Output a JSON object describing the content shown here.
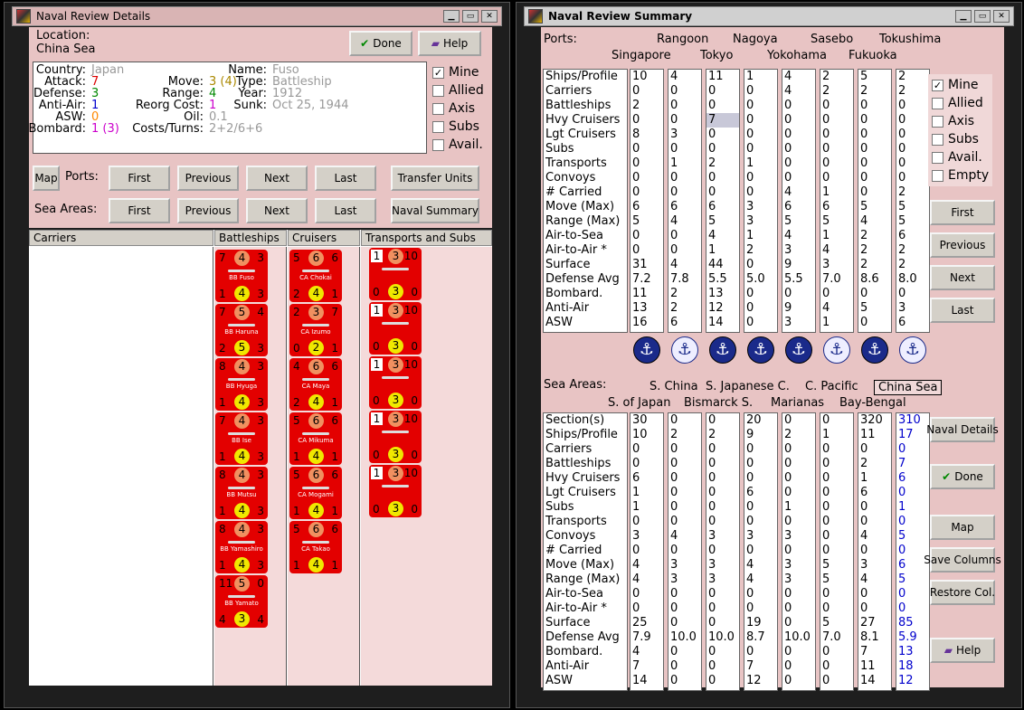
{
  "left": {
    "title": "Naval Review Details",
    "location_label": "Location:",
    "location_value": "China Sea",
    "done": "Done",
    "help": "Help",
    "info": {
      "country_l": "Country:",
      "country": "Japan",
      "attack_l": "Attack:",
      "attack": "7",
      "defense_l": "Defense:",
      "defense": "3",
      "antiair_l": "Anti-Air:",
      "antiair": "1",
      "asw_l": "ASW:",
      "asw": "0",
      "bombard_l": "Bombard:",
      "bombard": "1 (3)",
      "move_l": "Move:",
      "move": "3 (4)",
      "range_l": "Range:",
      "range": "4",
      "reorg_l": "Reorg Cost:",
      "reorg": "1",
      "oil_l": "Oil:",
      "oil": "0.1",
      "cost_l": "Costs/Turns:",
      "cost": "2+2/6+6",
      "name_l": "Name:",
      "name": "Fuso",
      "type_l": "Type:",
      "type": "Battleship",
      "year_l": "Year:",
      "year": "1912",
      "sunk_l": "Sunk:",
      "sunk": "Oct 25, 1944"
    },
    "checks": [
      "Mine",
      "Allied",
      "Axis",
      "Subs",
      "Avail."
    ],
    "map": "Map",
    "ports_l": "Ports:",
    "seas_l": "Sea Areas:",
    "nav": [
      "First",
      "Previous",
      "Next",
      "Last"
    ],
    "transfer": "Transfer Units",
    "naval_summary": "Naval Summary",
    "cols": [
      "Carriers",
      "Battleships",
      "Cruisers",
      "Transports and Subs"
    ],
    "battleships": [
      {
        "a": "7",
        "b": "4",
        "c": "3",
        "n": "BB Fuso",
        "d": "1",
        "e": "4",
        "f": "3"
      },
      {
        "a": "7",
        "b": "5",
        "c": "4",
        "n": "BB Haruna",
        "d": "2",
        "e": "5",
        "f": "3"
      },
      {
        "a": "8",
        "b": "4",
        "c": "3",
        "n": "BB Hyuga",
        "d": "1",
        "e": "4",
        "f": "3"
      },
      {
        "a": "7",
        "b": "4",
        "c": "3",
        "n": "BB Ise",
        "d": "1",
        "e": "4",
        "f": "3"
      },
      {
        "a": "8",
        "b": "4",
        "c": "3",
        "n": "BB Mutsu",
        "d": "1",
        "e": "4",
        "f": "3"
      },
      {
        "a": "8",
        "b": "4",
        "c": "3",
        "n": "BB Yamashiro",
        "d": "1",
        "e": "4",
        "f": "3"
      },
      {
        "a": "11",
        "b": "5",
        "c": "0",
        "n": "BB Yamato",
        "d": "4",
        "e": "3",
        "f": "4"
      }
    ],
    "cruisers": [
      {
        "a": "5",
        "b": "6",
        "c": "6",
        "n": "CA Chokai",
        "d": "2",
        "e": "4",
        "f": "1"
      },
      {
        "a": "2",
        "b": "3",
        "c": "7",
        "n": "CA Izumo",
        "d": "0",
        "e": "2",
        "f": "1"
      },
      {
        "a": "4",
        "b": "6",
        "c": "6",
        "n": "CA Maya",
        "d": "2",
        "e": "4",
        "f": "1"
      },
      {
        "a": "5",
        "b": "6",
        "c": "6",
        "n": "CA Mikuma",
        "d": "1",
        "e": "4",
        "f": "1"
      },
      {
        "a": "5",
        "b": "6",
        "c": "6",
        "n": "CA Mogami",
        "d": "1",
        "e": "4",
        "f": "1"
      },
      {
        "a": "5",
        "b": "6",
        "c": "6",
        "n": "CA Takao",
        "d": "1",
        "e": "4",
        "f": "1"
      }
    ],
    "transports": [
      {
        "a": "1",
        "b": "3",
        "c": "10",
        "d": "0",
        "e": "3",
        "f": "0"
      },
      {
        "a": "1",
        "b": "3",
        "c": "10",
        "d": "0",
        "e": "3",
        "f": "0"
      },
      {
        "a": "1",
        "b": "3",
        "c": "10",
        "d": "0",
        "e": "3",
        "f": "0"
      },
      {
        "a": "1",
        "b": "3",
        "c": "10",
        "d": "0",
        "e": "3",
        "f": "0"
      },
      {
        "a": "1",
        "b": "3",
        "c": "10",
        "d": "0",
        "e": "3",
        "f": "0"
      }
    ]
  },
  "right": {
    "title": "Naval Review Summary",
    "ports_l": "Ports:",
    "ports_top": [
      "Rangoon",
      "Nagoya",
      "Sasebo",
      "Tokushima"
    ],
    "ports_bot": [
      "Singapore",
      "Tokyo",
      "Yokohama",
      "Fukuoka"
    ],
    "rows": [
      "Ships/Profile",
      "Carriers",
      "Battleships",
      "Hvy Cruisers",
      "Lgt Cruisers",
      "Subs",
      "Transports",
      "Convoys",
      "# Carried",
      "Move (Max)",
      "Range (Max)",
      "Air-to-Sea",
      "Air-to-Air *",
      "Surface",
      "Defense Avg",
      "Bombard.",
      "Anti-Air",
      "ASW"
    ],
    "port_cols": [
      [
        "10",
        "0",
        "2",
        "0",
        "8",
        "0",
        "0",
        "0",
        "0",
        "6",
        "5",
        "0",
        "0",
        "31",
        "7.2",
        "11",
        "13",
        "16"
      ],
      [
        "4",
        "0",
        "0",
        "0",
        "3",
        "0",
        "1",
        "0",
        "0",
        "6",
        "4",
        "0",
        "0",
        "4",
        "7.8",
        "2",
        "2",
        "6"
      ],
      [
        "11",
        "0",
        "0",
        "7",
        "0",
        "0",
        "2",
        "0",
        "0",
        "6",
        "5",
        "4",
        "1",
        "44",
        "5.5",
        "13",
        "12",
        "14"
      ],
      [
        "1",
        "0",
        "0",
        "0",
        "0",
        "0",
        "1",
        "0",
        "0",
        "3",
        "3",
        "1",
        "2",
        "0",
        "5.0",
        "0",
        "0",
        "0"
      ],
      [
        "4",
        "4",
        "0",
        "0",
        "0",
        "0",
        "0",
        "0",
        "4",
        "6",
        "5",
        "4",
        "3",
        "9",
        "5.5",
        "0",
        "9",
        "3"
      ],
      [
        "2",
        "2",
        "0",
        "0",
        "0",
        "0",
        "0",
        "0",
        "1",
        "6",
        "5",
        "1",
        "4",
        "3",
        "7.0",
        "0",
        "4",
        "1"
      ],
      [
        "5",
        "2",
        "0",
        "0",
        "0",
        "0",
        "0",
        "0",
        "0",
        "5",
        "4",
        "2",
        "2",
        "2",
        "8.6",
        "0",
        "5",
        "0"
      ],
      [
        "2",
        "2",
        "0",
        "0",
        "0",
        "0",
        "0",
        "0",
        "2",
        "5",
        "5",
        "6",
        "2",
        "2",
        "8.0",
        "0",
        "3",
        "6"
      ]
    ],
    "port_anchor_style": [
      "dark",
      "light",
      "dark",
      "dark",
      "dark",
      "light",
      "dark",
      "light"
    ],
    "checks": [
      "Mine",
      "Allied",
      "Axis",
      "Subs",
      "Avail.",
      "Empty"
    ],
    "nav": [
      "First",
      "Previous",
      "Next",
      "Last"
    ],
    "seas_l": "Sea Areas:",
    "seas_top": [
      "S. China",
      "S. Japanese C.",
      "C. Pacific",
      "China Sea"
    ],
    "seas_bot": [
      "S. of Japan",
      "Bismarck S.",
      "Marianas",
      "Bay-Bengal"
    ],
    "sea_rows": [
      "Section(s)",
      "Ships/Profile",
      "Carriers",
      "Battleships",
      "Hvy Cruisers",
      "Lgt Cruisers",
      "Subs",
      "Transports",
      "Convoys",
      "# Carried",
      "Move (Max)",
      "Range (Max)",
      "Air-to-Sea",
      "Air-to-Air *",
      "Surface",
      "Defense Avg",
      "Bombard.",
      "Anti-Air",
      "ASW"
    ],
    "sea_cols": [
      [
        "30",
        "10",
        "0",
        "0",
        "6",
        "1",
        "1",
        "0",
        "3",
        "0",
        "4",
        "4",
        "0",
        "0",
        "25",
        "7.9",
        "4",
        "7",
        "14"
      ],
      [
        "0",
        "2",
        "0",
        "0",
        "0",
        "0",
        "0",
        "0",
        "4",
        "0",
        "3",
        "3",
        "0",
        "0",
        "0",
        "10.0",
        "0",
        "0",
        "0"
      ],
      [
        "0",
        "2",
        "0",
        "0",
        "0",
        "0",
        "0",
        "0",
        "3",
        "0",
        "3",
        "3",
        "0",
        "0",
        "0",
        "10.0",
        "0",
        "0",
        "0"
      ],
      [
        "20",
        "9",
        "0",
        "0",
        "0",
        "6",
        "0",
        "0",
        "3",
        "0",
        "4",
        "4",
        "0",
        "0",
        "19",
        "8.7",
        "0",
        "7",
        "12"
      ],
      [
        "0",
        "2",
        "0",
        "0",
        "0",
        "0",
        "1",
        "0",
        "3",
        "0",
        "3",
        "3",
        "0",
        "0",
        "0",
        "10.0",
        "0",
        "0",
        "0"
      ],
      [
        "0",
        "1",
        "0",
        "0",
        "0",
        "0",
        "0",
        "0",
        "0",
        "0",
        "5",
        "5",
        "0",
        "0",
        "5",
        "7.0",
        "0",
        "0",
        "0"
      ],
      [
        "320",
        "11",
        "0",
        "2",
        "1",
        "6",
        "0",
        "0",
        "4",
        "0",
        "3",
        "4",
        "0",
        "0",
        "27",
        "8.1",
        "7",
        "11",
        "14"
      ],
      [
        "310",
        "17",
        "0",
        "7",
        "6",
        "0",
        "1",
        "0",
        "5",
        "0",
        "6",
        "5",
        "0",
        "0",
        "85",
        "5.9",
        "13",
        "18",
        "12"
      ]
    ],
    "naval_details": "Naval Details",
    "done": "Done",
    "map": "Map",
    "save": "Save Columns",
    "restore": "Restore Col.",
    "help": "Help"
  }
}
